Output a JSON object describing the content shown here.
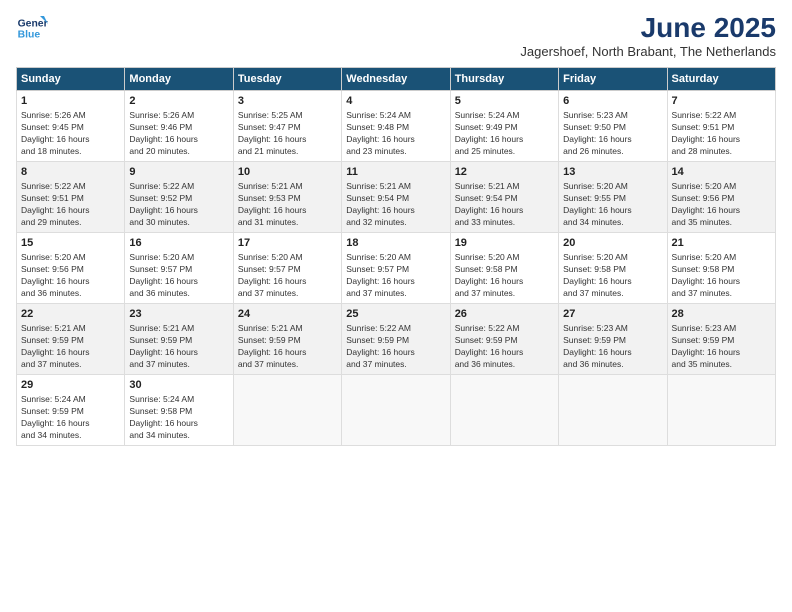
{
  "header": {
    "logo_line1": "General",
    "logo_line2": "Blue",
    "title": "June 2025",
    "subtitle": "Jagershoef, North Brabant, The Netherlands"
  },
  "days_of_week": [
    "Sunday",
    "Monday",
    "Tuesday",
    "Wednesday",
    "Thursday",
    "Friday",
    "Saturday"
  ],
  "weeks": [
    [
      {
        "day": 1,
        "info": "Sunrise: 5:26 AM\nSunset: 9:45 PM\nDaylight: 16 hours\nand 18 minutes."
      },
      {
        "day": 2,
        "info": "Sunrise: 5:26 AM\nSunset: 9:46 PM\nDaylight: 16 hours\nand 20 minutes."
      },
      {
        "day": 3,
        "info": "Sunrise: 5:25 AM\nSunset: 9:47 PM\nDaylight: 16 hours\nand 21 minutes."
      },
      {
        "day": 4,
        "info": "Sunrise: 5:24 AM\nSunset: 9:48 PM\nDaylight: 16 hours\nand 23 minutes."
      },
      {
        "day": 5,
        "info": "Sunrise: 5:24 AM\nSunset: 9:49 PM\nDaylight: 16 hours\nand 25 minutes."
      },
      {
        "day": 6,
        "info": "Sunrise: 5:23 AM\nSunset: 9:50 PM\nDaylight: 16 hours\nand 26 minutes."
      },
      {
        "day": 7,
        "info": "Sunrise: 5:22 AM\nSunset: 9:51 PM\nDaylight: 16 hours\nand 28 minutes."
      }
    ],
    [
      {
        "day": 8,
        "info": "Sunrise: 5:22 AM\nSunset: 9:51 PM\nDaylight: 16 hours\nand 29 minutes."
      },
      {
        "day": 9,
        "info": "Sunrise: 5:22 AM\nSunset: 9:52 PM\nDaylight: 16 hours\nand 30 minutes."
      },
      {
        "day": 10,
        "info": "Sunrise: 5:21 AM\nSunset: 9:53 PM\nDaylight: 16 hours\nand 31 minutes."
      },
      {
        "day": 11,
        "info": "Sunrise: 5:21 AM\nSunset: 9:54 PM\nDaylight: 16 hours\nand 32 minutes."
      },
      {
        "day": 12,
        "info": "Sunrise: 5:21 AM\nSunset: 9:54 PM\nDaylight: 16 hours\nand 33 minutes."
      },
      {
        "day": 13,
        "info": "Sunrise: 5:20 AM\nSunset: 9:55 PM\nDaylight: 16 hours\nand 34 minutes."
      },
      {
        "day": 14,
        "info": "Sunrise: 5:20 AM\nSunset: 9:56 PM\nDaylight: 16 hours\nand 35 minutes."
      }
    ],
    [
      {
        "day": 15,
        "info": "Sunrise: 5:20 AM\nSunset: 9:56 PM\nDaylight: 16 hours\nand 36 minutes."
      },
      {
        "day": 16,
        "info": "Sunrise: 5:20 AM\nSunset: 9:57 PM\nDaylight: 16 hours\nand 36 minutes."
      },
      {
        "day": 17,
        "info": "Sunrise: 5:20 AM\nSunset: 9:57 PM\nDaylight: 16 hours\nand 37 minutes."
      },
      {
        "day": 18,
        "info": "Sunrise: 5:20 AM\nSunset: 9:57 PM\nDaylight: 16 hours\nand 37 minutes."
      },
      {
        "day": 19,
        "info": "Sunrise: 5:20 AM\nSunset: 9:58 PM\nDaylight: 16 hours\nand 37 minutes."
      },
      {
        "day": 20,
        "info": "Sunrise: 5:20 AM\nSunset: 9:58 PM\nDaylight: 16 hours\nand 37 minutes."
      },
      {
        "day": 21,
        "info": "Sunrise: 5:20 AM\nSunset: 9:58 PM\nDaylight: 16 hours\nand 37 minutes."
      }
    ],
    [
      {
        "day": 22,
        "info": "Sunrise: 5:21 AM\nSunset: 9:59 PM\nDaylight: 16 hours\nand 37 minutes."
      },
      {
        "day": 23,
        "info": "Sunrise: 5:21 AM\nSunset: 9:59 PM\nDaylight: 16 hours\nand 37 minutes."
      },
      {
        "day": 24,
        "info": "Sunrise: 5:21 AM\nSunset: 9:59 PM\nDaylight: 16 hours\nand 37 minutes."
      },
      {
        "day": 25,
        "info": "Sunrise: 5:22 AM\nSunset: 9:59 PM\nDaylight: 16 hours\nand 37 minutes."
      },
      {
        "day": 26,
        "info": "Sunrise: 5:22 AM\nSunset: 9:59 PM\nDaylight: 16 hours\nand 36 minutes."
      },
      {
        "day": 27,
        "info": "Sunrise: 5:23 AM\nSunset: 9:59 PM\nDaylight: 16 hours\nand 36 minutes."
      },
      {
        "day": 28,
        "info": "Sunrise: 5:23 AM\nSunset: 9:59 PM\nDaylight: 16 hours\nand 35 minutes."
      }
    ],
    [
      {
        "day": 29,
        "info": "Sunrise: 5:24 AM\nSunset: 9:59 PM\nDaylight: 16 hours\nand 34 minutes."
      },
      {
        "day": 30,
        "info": "Sunrise: 5:24 AM\nSunset: 9:58 PM\nDaylight: 16 hours\nand 34 minutes."
      },
      null,
      null,
      null,
      null,
      null
    ]
  ]
}
